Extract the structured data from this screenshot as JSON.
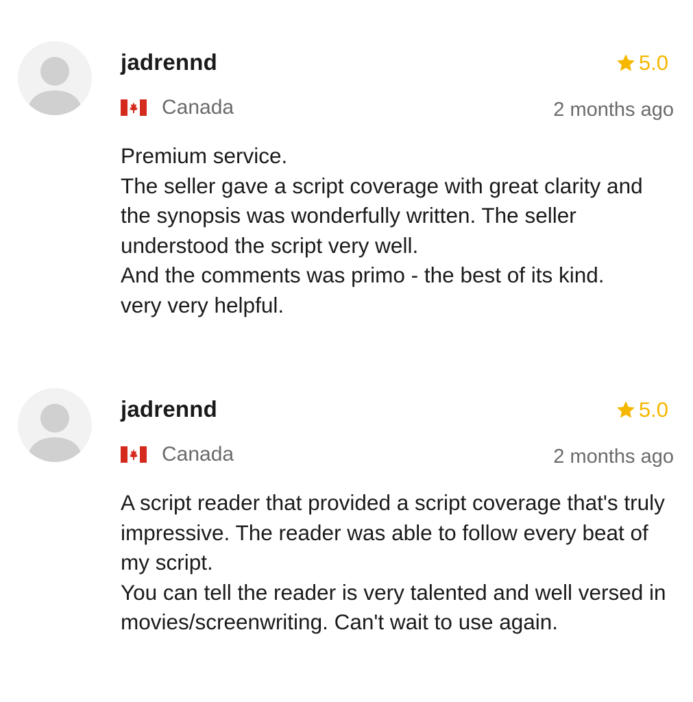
{
  "reviews": [
    {
      "username": "jadrennd",
      "country": "Canada",
      "flag_icon": "canada-flag-icon",
      "rating": "5.0",
      "time": "2 months ago",
      "text": "Premium service.\nThe seller gave a script coverage with great clarity and the synopsis was wonderfully written. The seller understood the script very well.\nAnd the comments was primo - the best of its kind.\nvery very helpful."
    },
    {
      "username": "jadrennd",
      "country": "Canada",
      "flag_icon": "canada-flag-icon",
      "rating": "5.0",
      "time": "2 months ago",
      "text": "A script reader that provided a script coverage that's truly impressive. The reader was able to follow every beat of  my script.\nYou can tell the reader is very talented and well versed in movies/screenwriting. Can't wait to use again."
    }
  ],
  "colors": {
    "star": "#f5b700",
    "muted_text": "#6a6a6a",
    "avatar_bg": "#f2f2f2",
    "avatar_fg": "#d0d0d0",
    "flag_red": "#d52b1e"
  }
}
